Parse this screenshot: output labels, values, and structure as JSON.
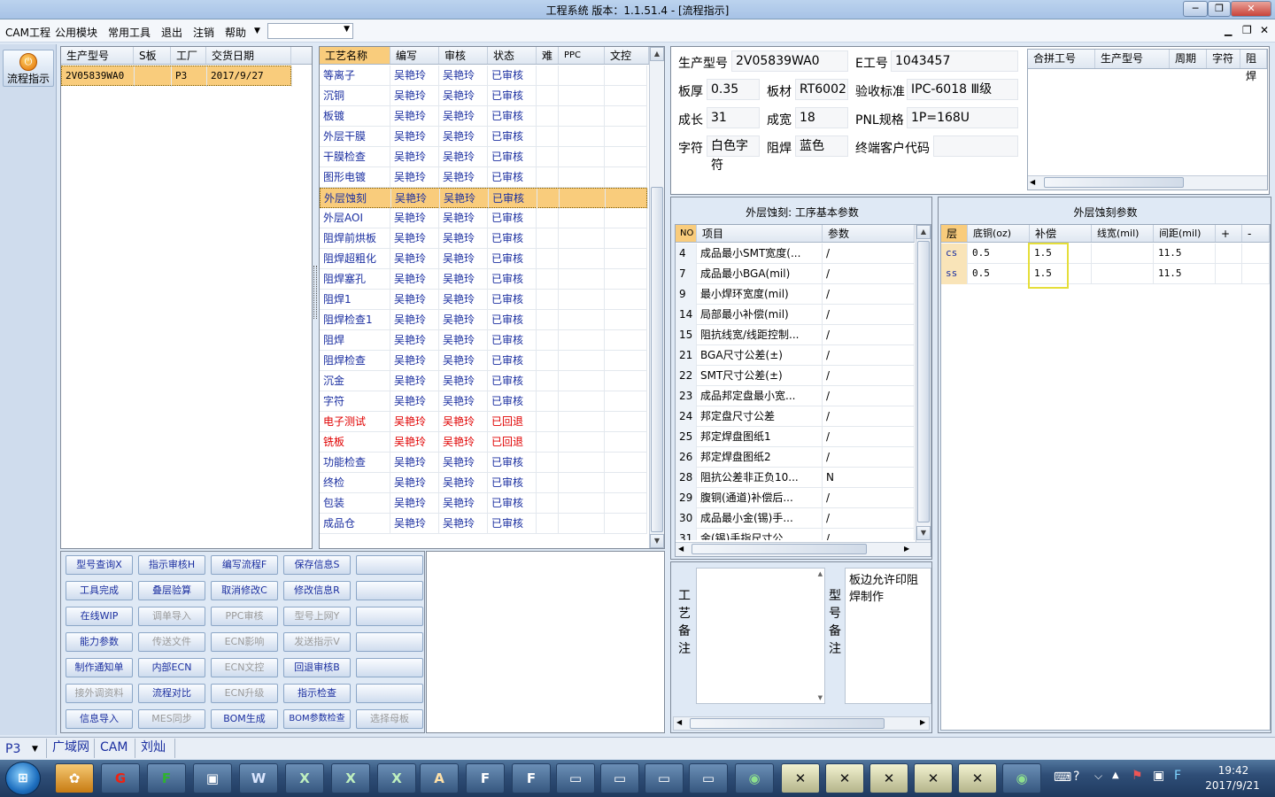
{
  "window": {
    "title": "工程系统   版本：1.1.51.4 - [流程指示]"
  },
  "menu": {
    "items": [
      "CAM工程",
      "公用模块",
      "常用工具",
      "退出",
      "注销",
      "帮助"
    ]
  },
  "sidebar": {
    "flow_button": "流程指示"
  },
  "orders": {
    "columns": [
      "生产型号",
      "S板",
      "工厂",
      "交货日期"
    ],
    "rows": [
      [
        "2V05839WA0",
        "",
        "P3",
        "2017/9/27"
      ]
    ]
  },
  "process": {
    "columns": [
      "工艺名称",
      "编写",
      "审核",
      "状态",
      "难",
      "PPC",
      "文控"
    ],
    "rows": [
      {
        "name": "等离子",
        "writer": "吴艳玲",
        "reviewer": "吴艳玲",
        "status": "已审核"
      },
      {
        "name": "沉铜",
        "writer": "吴艳玲",
        "reviewer": "吴艳玲",
        "status": "已审核"
      },
      {
        "name": "板镀",
        "writer": "吴艳玲",
        "reviewer": "吴艳玲",
        "status": "已审核"
      },
      {
        "name": "外层干膜",
        "writer": "吴艳玲",
        "reviewer": "吴艳玲",
        "status": "已审核"
      },
      {
        "name": "干膜检查",
        "writer": "吴艳玲",
        "reviewer": "吴艳玲",
        "status": "已审核"
      },
      {
        "name": "图形电镀",
        "writer": "吴艳玲",
        "reviewer": "吴艳玲",
        "status": "已审核"
      },
      {
        "name": "外层蚀刻",
        "writer": "吴艳玲",
        "reviewer": "吴艳玲",
        "status": "已审核"
      },
      {
        "name": "外层AOI",
        "writer": "吴艳玲",
        "reviewer": "吴艳玲",
        "status": "已审核"
      },
      {
        "name": "阻焊前烘板",
        "writer": "吴艳玲",
        "reviewer": "吴艳玲",
        "status": "已审核"
      },
      {
        "name": "阻焊超粗化",
        "writer": "吴艳玲",
        "reviewer": "吴艳玲",
        "status": "已审核"
      },
      {
        "name": "阻焊塞孔",
        "writer": "吴艳玲",
        "reviewer": "吴艳玲",
        "status": "已审核"
      },
      {
        "name": "阻焊1",
        "writer": "吴艳玲",
        "reviewer": "吴艳玲",
        "status": "已审核"
      },
      {
        "name": "阻焊检查1",
        "writer": "吴艳玲",
        "reviewer": "吴艳玲",
        "status": "已审核"
      },
      {
        "name": "阻焊",
        "writer": "吴艳玲",
        "reviewer": "吴艳玲",
        "status": "已审核"
      },
      {
        "name": "阻焊检查",
        "writer": "吴艳玲",
        "reviewer": "吴艳玲",
        "status": "已审核"
      },
      {
        "name": "沉金",
        "writer": "吴艳玲",
        "reviewer": "吴艳玲",
        "status": "已审核"
      },
      {
        "name": "字符",
        "writer": "吴艳玲",
        "reviewer": "吴艳玲",
        "status": "已审核"
      },
      {
        "name": "电子测试",
        "writer": "吴艳玲",
        "reviewer": "吴艳玲",
        "status": "已回退"
      },
      {
        "name": "铣板",
        "writer": "吴艳玲",
        "reviewer": "吴艳玲",
        "status": "已回退"
      },
      {
        "name": "功能检查",
        "writer": "吴艳玲",
        "reviewer": "吴艳玲",
        "status": "已审核"
      },
      {
        "name": "终检",
        "writer": "吴艳玲",
        "reviewer": "吴艳玲",
        "status": "已审核"
      },
      {
        "name": "包装",
        "writer": "吴艳玲",
        "reviewer": "吴艳玲",
        "status": "已审核"
      },
      {
        "name": "成品仓",
        "writer": "吴艳玲",
        "reviewer": "吴艳玲",
        "status": "已审核"
      }
    ]
  },
  "actions": {
    "rows": [
      [
        "型号查询X",
        "指示审核H",
        "编写流程F",
        "保存信息S",
        ""
      ],
      [
        "工具完成",
        "叠层验算",
        "取消修改C",
        "修改信息R",
        ""
      ],
      [
        "在线WIP",
        "调单导入",
        "PPC审核",
        "型号上网Y",
        ""
      ],
      [
        "能力参数",
        "传送文件",
        "ECN影响",
        "发送指示V",
        ""
      ],
      [
        "制作通知单",
        "内部ECN",
        "ECN文控",
        "回退审核B",
        ""
      ],
      [
        "接外调资料",
        "流程对比",
        "ECN升级",
        "指示检查",
        ""
      ],
      [
        "信息导入",
        "MES同步",
        "BOM生成",
        "BOM参数检查",
        "选择母板"
      ]
    ]
  },
  "info": {
    "l_model": "生产型号",
    "v_model": "2V05839WA0",
    "l_eno": "E工号",
    "v_eno": "1043457",
    "l_thick": "板厚",
    "v_thick": "0.35",
    "l_mat": "板材",
    "v_mat": "RT6002",
    "l_std": "验收标准",
    "v_std": "IPC-6018 Ⅲ级",
    "l_len": "成长",
    "v_len": "31",
    "l_wid": "成宽",
    "v_wid": "18",
    "l_pnl": "PNL规格",
    "v_pnl": "1P=168U",
    "l_char": "字符",
    "v_char": "白色字符",
    "l_mask": "阻焊",
    "v_mask": "蓝色",
    "l_cust": "终端客户代码",
    "v_cust": ""
  },
  "merge": {
    "columns": [
      "合拼工号",
      "生产型号",
      "周期",
      "字符",
      "阻焊"
    ]
  },
  "basic": {
    "title": "外层蚀刻: 工序基本参数",
    "columns": [
      "NO",
      "项目",
      "参数"
    ],
    "rows": [
      [
        "4",
        "成品最小SMT宽度(...",
        "/"
      ],
      [
        "7",
        "成品最小BGA(mil)",
        "/"
      ],
      [
        "9",
        "最小焊环宽度(mil)",
        "/"
      ],
      [
        "14",
        "局部最小补偿(mil)",
        "/"
      ],
      [
        "15",
        "阻抗线宽/线距控制...",
        "/"
      ],
      [
        "21",
        "BGA尺寸公差(±)",
        "/"
      ],
      [
        "22",
        "SMT尺寸公差(±)",
        "/"
      ],
      [
        "23",
        "成品邦定盘最小宽...",
        "/"
      ],
      [
        "24",
        "邦定盘尺寸公差",
        "/"
      ],
      [
        "25",
        "邦定焊盘图纸1",
        "/"
      ],
      [
        "26",
        "邦定焊盘图纸2",
        "/"
      ],
      [
        "28",
        "阻抗公差非正负10...",
        "N"
      ],
      [
        "29",
        "腹铜(通道)补偿后...",
        "/"
      ],
      [
        "30",
        "成品最小金(锡)手...",
        "/"
      ],
      [
        "31",
        "金(锡)手指尺寸公...",
        "/"
      ]
    ]
  },
  "etch": {
    "title": "外层蚀刻参数",
    "columns": [
      "层",
      "底铜(oz)",
      "补偿",
      "线宽(mil)",
      "间距(mil)",
      "+",
      "-"
    ],
    "rows": [
      [
        "cs",
        "0.5",
        "1.5",
        "",
        "11.5",
        "",
        ""
      ],
      [
        "ss",
        "0.5",
        "1.5",
        "",
        "11.5",
        "",
        ""
      ]
    ]
  },
  "notes": {
    "craft_label": "工艺备注",
    "model_label": "型号备注",
    "model_text": "板边允许印阻焊制作"
  },
  "status": {
    "factory": "P3",
    "network": "广域网",
    "dept": "CAM",
    "user": "刘灿"
  },
  "taskbar": {
    "time": "19:42",
    "date": "2017/9/21"
  }
}
